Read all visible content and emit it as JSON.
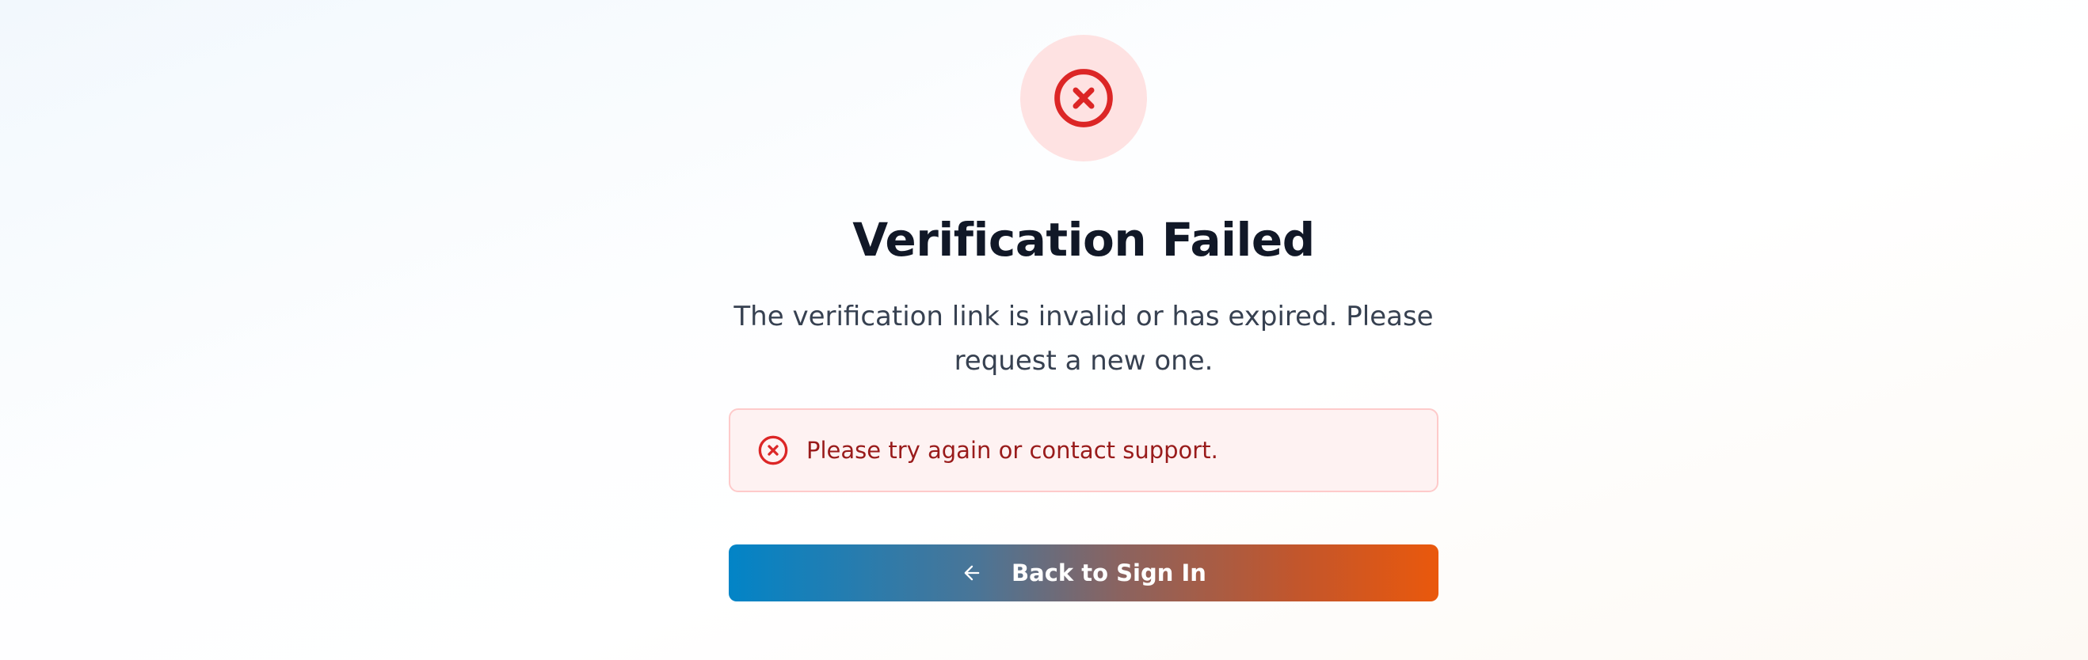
{
  "status": {
    "icon": "x-circle-icon",
    "accent_color": "#dc2626",
    "circle_bg": "#fee2e2"
  },
  "heading": {
    "title": "Verification Failed",
    "message": "The verification link is invalid or has expired. Please request a new one."
  },
  "alert": {
    "icon": "x-circle-icon",
    "text": "Please try again or contact support.",
    "text_color": "#991b1b",
    "bg_color": "#fef2f2",
    "border_color": "#fecaca"
  },
  "back_button": {
    "icon": "arrow-left-icon",
    "label": "Back to Sign In",
    "gradient_start": "#0284c7",
    "gradient_end": "#ea580c"
  }
}
